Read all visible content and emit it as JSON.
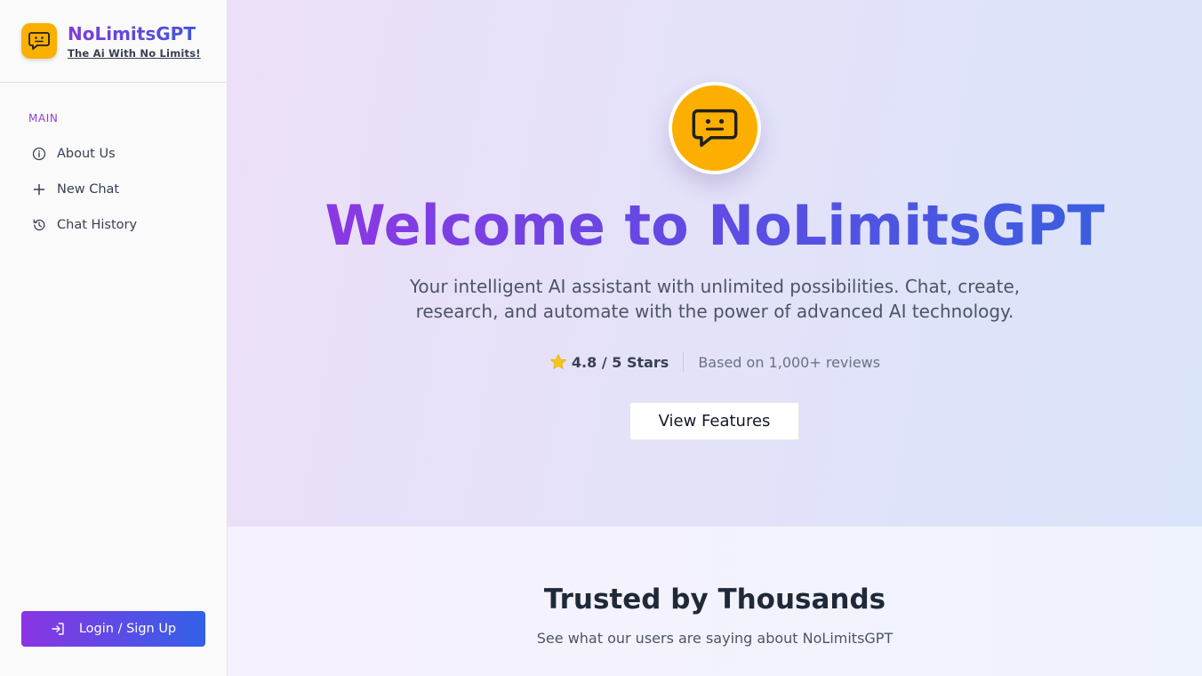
{
  "brand": {
    "name": "NoLimitsGPT",
    "tagline": "The Ai With No Limits!"
  },
  "sidebar": {
    "section_label": "MAIN",
    "items": [
      {
        "label": "About Us",
        "icon": "info-icon"
      },
      {
        "label": "New Chat",
        "icon": "plus-icon"
      },
      {
        "label": "Chat History",
        "icon": "history-icon"
      }
    ],
    "login_label": "Login / Sign Up"
  },
  "hero": {
    "title": "Welcome to NoLimitsGPT",
    "subtitle": "Your intelligent AI assistant with unlimited possibilities. Chat, create, research, and automate with the power of advanced AI technology.",
    "rating_text": "4.8 / 5 Stars",
    "reviews_text": "Based on 1,000+ reviews",
    "cta_label": "View Features"
  },
  "trusted": {
    "title": "Trusted by Thousands",
    "subtitle": "See what our users are saying about NoLimitsGPT"
  },
  "colors": {
    "logo_bg": "#fbb000",
    "accent_purple": "#8b38e3",
    "accent_blue": "#3b5ee0",
    "star": "#f5c518"
  }
}
